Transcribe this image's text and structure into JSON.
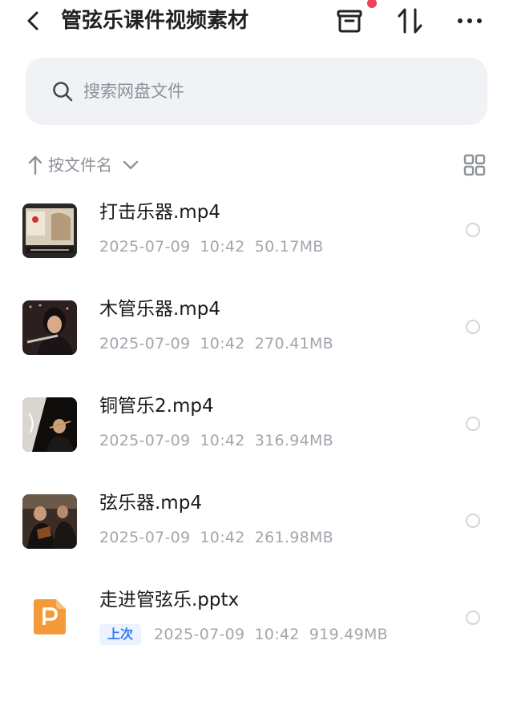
{
  "header": {
    "title": "管弦乐课件视频素材"
  },
  "search": {
    "placeholder": "搜索网盘文件"
  },
  "sort": {
    "label": "按文件名"
  },
  "files": [
    {
      "name": "打击乐器.mp4",
      "date": "2025-07-09",
      "time": "10:42",
      "size": "50.17MB",
      "icon": "video-thumbnail"
    },
    {
      "name": "木管乐器.mp4",
      "date": "2025-07-09",
      "time": "10:42",
      "size": "270.41MB",
      "icon": "video-thumbnail"
    },
    {
      "name": "铜管乐2.mp4",
      "date": "2025-07-09",
      "time": "10:42",
      "size": "316.94MB",
      "icon": "video-thumbnail"
    },
    {
      "name": "弦乐器.mp4",
      "date": "2025-07-09",
      "time": "10:42",
      "size": "261.98MB",
      "icon": "video-thumbnail"
    },
    {
      "name": "走进管弦乐.pptx",
      "badge": "上次",
      "date": "2025-07-09",
      "time": "10:42",
      "size": "919.49MB",
      "icon": "ppt-file-icon"
    }
  ],
  "colors": {
    "accent": "#2f7bf0",
    "ppt_orange": "#f59a3a",
    "notification": "#f0415b"
  }
}
